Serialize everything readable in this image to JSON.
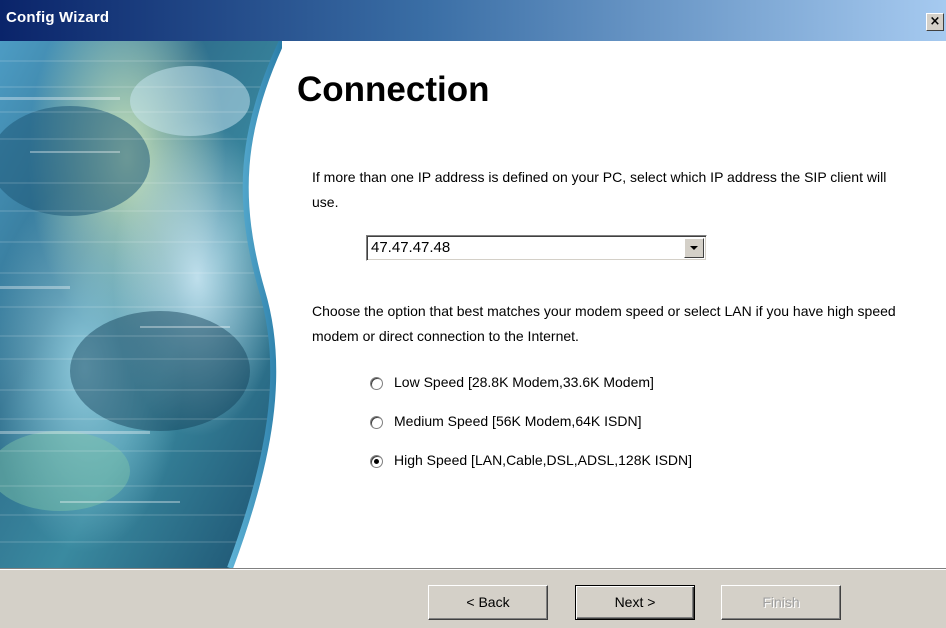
{
  "window": {
    "title": "Config Wizard",
    "close_label": "×"
  },
  "page": {
    "title": "Connection",
    "ip_instruction": "If more than one IP address is defined on your PC, select which IP address the SIP client will use.",
    "ip_select": {
      "value": "47.47.47.48"
    },
    "speed_instruction": "Choose the option that best matches your modem speed or select LAN if you have high speed modem or direct connection to the Internet.",
    "speed_options": [
      {
        "label": "Low Speed [28.8K Modem,33.6K Modem]",
        "checked": false
      },
      {
        "label": "Medium Speed [56K Modem,64K ISDN]",
        "checked": false
      },
      {
        "label": "High Speed [LAN,Cable,DSL,ADSL,128K ISDN]",
        "checked": true
      }
    ]
  },
  "buttons": {
    "back": "< Back",
    "next": "Next >",
    "finish": "Finish"
  },
  "colors": {
    "titlebar_start": "#0a246a",
    "titlebar_end": "#a6caf0",
    "dialog_face": "#d4d0c8"
  }
}
